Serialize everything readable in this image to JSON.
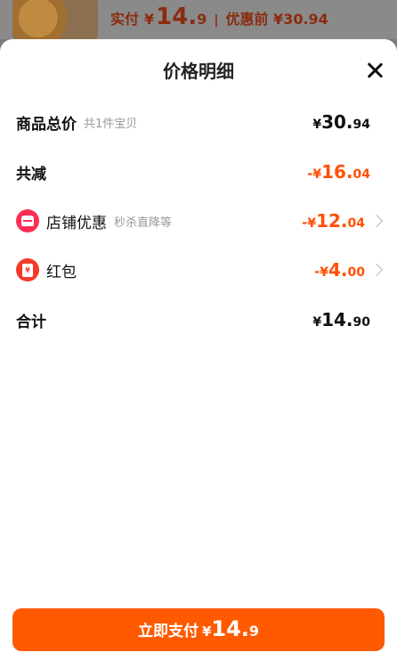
{
  "background_strip": {
    "price_label": "实付",
    "currency": "¥",
    "price_int": "14.",
    "price_dec": "9",
    "separator": "|",
    "original_price": "优惠前 ¥30.94"
  },
  "sheet": {
    "title": "价格明细",
    "rows": [
      {
        "label": "商品总价",
        "sub": "共1件宝贝",
        "sign": "",
        "currency": "¥",
        "int": "30.",
        "dec": "94"
      },
      {
        "label": "共减",
        "sub": "",
        "sign": "-",
        "currency": "¥",
        "int": "16.",
        "dec": "04"
      },
      {
        "label": "店铺优惠",
        "sub": "秒杀直降等",
        "sign": "-",
        "currency": "¥",
        "int": "12.",
        "dec": "04",
        "icon": "shop-icon"
      },
      {
        "label": "红包",
        "sub": "",
        "sign": "-",
        "currency": "¥",
        "int": "4.",
        "dec": "00",
        "icon": "red-envelope-icon",
        "icon_glyph": "¥"
      },
      {
        "label": "合计",
        "sub": "",
        "sign": "",
        "currency": "¥",
        "int": "14.",
        "dec": "90"
      }
    ]
  },
  "pay_button": {
    "label": "立即支付",
    "currency": "¥",
    "int": "14.",
    "dec": "9"
  },
  "colors": {
    "accent": "#ff5000",
    "button": "#ff5a00",
    "shop_icon": "#ff2d55",
    "red_envelope_icon": "#f53a2a"
  }
}
